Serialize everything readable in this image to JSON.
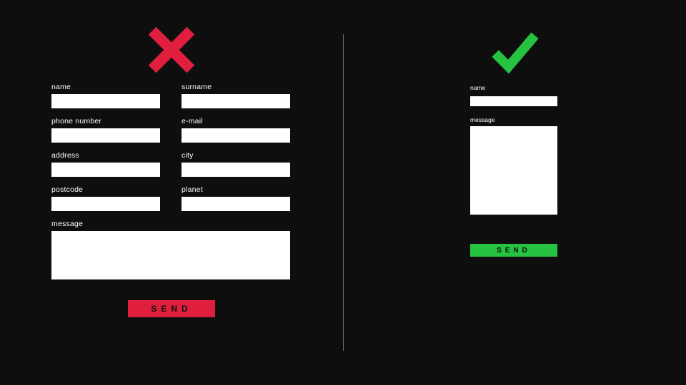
{
  "colors": {
    "bad": "#df1f3d",
    "good": "#26c340",
    "bg": "#0e0e0e",
    "input_bg": "#ffffff"
  },
  "bad": {
    "icon": "cross",
    "fields": {
      "name": {
        "label": "name",
        "value": ""
      },
      "surname": {
        "label": "surname",
        "value": ""
      },
      "phone": {
        "label": "phone number",
        "value": ""
      },
      "email": {
        "label": "e-mail",
        "value": ""
      },
      "address": {
        "label": "address",
        "value": ""
      },
      "city": {
        "label": "city",
        "value": ""
      },
      "postcode": {
        "label": "postcode",
        "value": ""
      },
      "planet": {
        "label": "planet",
        "value": ""
      },
      "message": {
        "label": "message",
        "value": ""
      }
    },
    "send_label": "SEND"
  },
  "good": {
    "icon": "check",
    "fields": {
      "name": {
        "label": "name",
        "value": ""
      },
      "message": {
        "label": "message",
        "value": ""
      }
    },
    "send_label": "SEND"
  }
}
